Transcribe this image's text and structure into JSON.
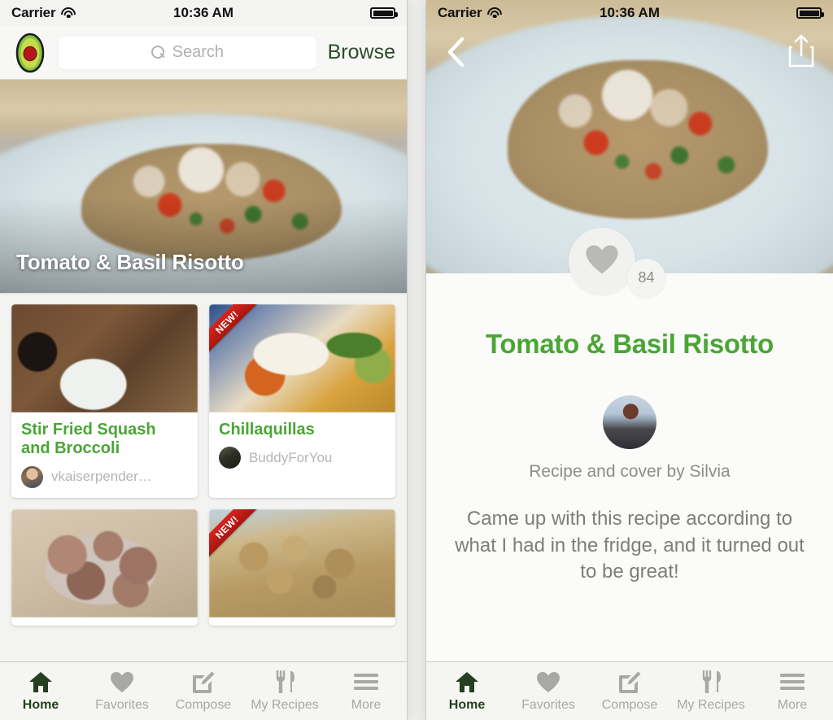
{
  "status_bar": {
    "carrier": "Carrier",
    "time": "10:36 AM",
    "wifi_icon": "wifi-icon",
    "battery_icon": "battery-full-icon"
  },
  "colors": {
    "brand_green": "#4aa535",
    "browse_green": "#2d4c2b",
    "active_tab": "#234021",
    "muted_text": "#b5b5b3",
    "ribbon_red": "#c4201a"
  },
  "home_screen": {
    "logo_icon": "avocado-logo-icon",
    "search": {
      "icon": "search-icon",
      "placeholder": "Search",
      "value": ""
    },
    "browse_label": "Browse",
    "hero": {
      "title": "Tomato & Basil Risotto",
      "image_alt": "risotto-photo"
    },
    "cards": [
      {
        "title": "Stir Fried Squash and Broccoli",
        "author": "vkaiserpender…",
        "badge": "",
        "image_alt": "squash-broccoli-photo",
        "avatar_alt": "author-avatar"
      },
      {
        "title": "Chillaquillas",
        "author": "BuddyForYou",
        "badge": "NEW!",
        "image_alt": "chillaquillas-photo",
        "avatar_alt": "author-avatar"
      },
      {
        "title": "",
        "author": "",
        "badge": "",
        "image_alt": "coconut-balls-photo",
        "avatar_alt": ""
      },
      {
        "title": "",
        "author": "",
        "badge": "NEW!",
        "image_alt": "granola-bars-photo",
        "avatar_alt": ""
      }
    ]
  },
  "detail_screen": {
    "back_icon": "chevron-left-icon",
    "share_icon": "share-icon",
    "like": {
      "icon": "heart-icon",
      "count": "84"
    },
    "title": "Tomato & Basil Risotto",
    "author_avatar_alt": "silvia-avatar",
    "credit": "Recipe and cover by Silvia",
    "description": "Came up with this recipe according to what I had in the fridge, and it turned out to be great!"
  },
  "tab_bar": {
    "items": [
      {
        "label": "Home",
        "icon": "home-icon",
        "active": true
      },
      {
        "label": "Favorites",
        "icon": "heart-icon",
        "active": false
      },
      {
        "label": "Compose",
        "icon": "compose-pencil-icon",
        "active": false
      },
      {
        "label": "My Recipes",
        "icon": "fork-knife-icon",
        "active": false
      },
      {
        "label": "More",
        "icon": "hamburger-menu-icon",
        "active": false
      }
    ]
  }
}
